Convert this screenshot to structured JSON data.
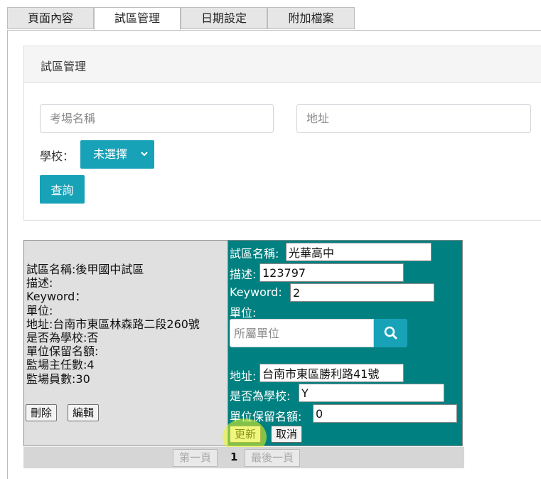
{
  "tabs": [
    {
      "label": "頁面內容"
    },
    {
      "label": "試區管理"
    },
    {
      "label": "日期設定"
    },
    {
      "label": "附加檔案"
    }
  ],
  "panel": {
    "title": "試區管理",
    "name_placeholder": "考場名稱",
    "address_placeholder": "地址",
    "school_label": "學校：",
    "school_value": "未選擇",
    "query_label": "查詢"
  },
  "record": {
    "info_lines": [
      "試區名稱:後甲國中試區",
      "描述:",
      "Keyword：",
      "單位:",
      "地址:台南市東區林森路二段260號",
      "是否為學校:否",
      "單位保留名額:",
      "監場主任數:4",
      "監場員數:30"
    ],
    "delete_label": "刪除",
    "edit_label": "編輯"
  },
  "edit": {
    "name_label": "試區名稱:",
    "name_value": "光華高中",
    "desc_label": "描述:",
    "desc_value": "123797",
    "keyword_label": "Keyword:",
    "keyword_value": "2",
    "unit_label": "單位:",
    "unit_placeholder": "所屬單位",
    "address_label": "地址:",
    "address_value": "台南市東區勝利路41號",
    "is_school_label": "是否為學校:",
    "is_school_value": "Y",
    "reserved_label": "單位保留名額:",
    "reserved_value": "0",
    "update_label": "更新",
    "cancel_label": "取消"
  },
  "pager": {
    "first_label": "第一頁",
    "current": "1",
    "last_label": "最後一頁"
  },
  "icons": {
    "search": "search-icon",
    "dropdown": "chevron-down-icon"
  },
  "colors": {
    "accent": "#17a2b8",
    "edit_panel": "#008080",
    "readonly_panel": "#e0e0e0"
  }
}
